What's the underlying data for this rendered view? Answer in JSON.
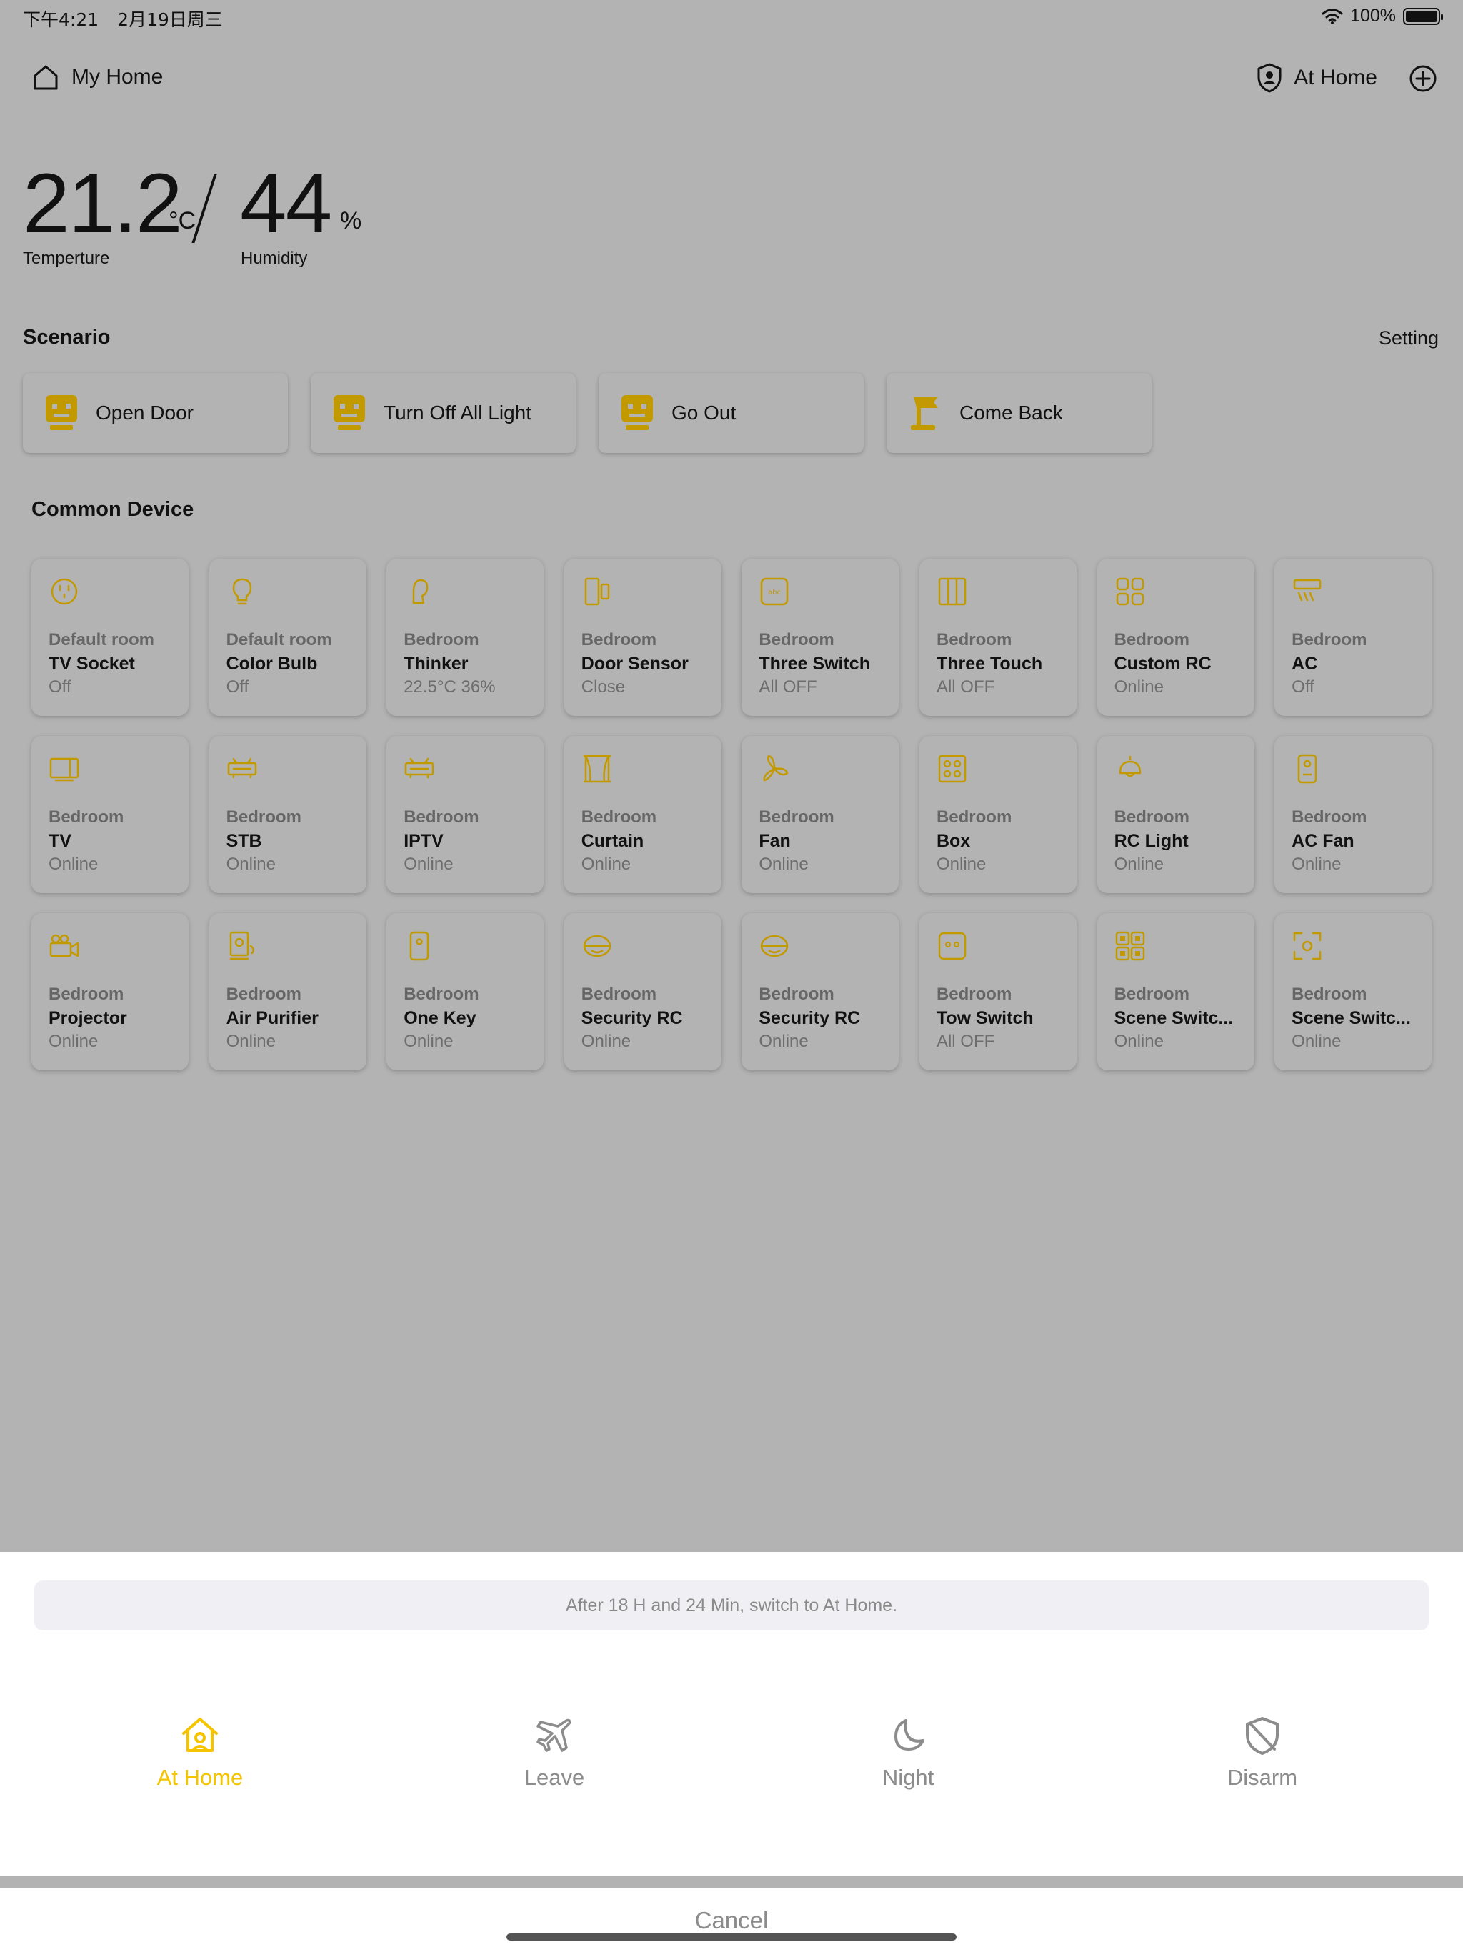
{
  "status_bar": {
    "time": "下午4:21",
    "date": "2月19日周三",
    "battery": "100%",
    "wifi_icon": "wifi-icon",
    "battery_icon": "battery-icon"
  },
  "header": {
    "home_label": "My Home",
    "mode_label": "At Home"
  },
  "climate": {
    "temperature": "21.2",
    "temperature_unit": "°C",
    "temperature_label": "Temperture",
    "humidity": "44",
    "humidity_unit": "%",
    "humidity_label": "Humidity"
  },
  "scenario": {
    "title": "Scenario",
    "setting_label": "Setting",
    "items": [
      {
        "label": "Open Door",
        "icon": "robot-icon"
      },
      {
        "label": "Turn Off All Light",
        "icon": "robot-icon"
      },
      {
        "label": "Go Out",
        "icon": "robot-icon"
      },
      {
        "label": "Come Back",
        "icon": "flag-icon"
      }
    ]
  },
  "devices": {
    "title": "Common Device",
    "items": [
      {
        "room": "Default room",
        "name": "TV Socket",
        "state": "Off",
        "icon": "socket-icon"
      },
      {
        "room": "Default room",
        "name": "Color Bulb",
        "state": "Off",
        "icon": "bulb-icon"
      },
      {
        "room": "Bedroom",
        "name": "Thinker",
        "state": "22.5°C 36%",
        "icon": "thinker-icon"
      },
      {
        "room": "Bedroom",
        "name": "Door Sensor",
        "state": "Close",
        "icon": "door-sensor-icon"
      },
      {
        "room": "Bedroom",
        "name": "Three Switch",
        "state": "All OFF",
        "icon": "switch-panel-icon"
      },
      {
        "room": "Bedroom",
        "name": "Three Touch",
        "state": "All OFF",
        "icon": "touch-panel-icon"
      },
      {
        "room": "Bedroom",
        "name": "Custom RC",
        "state": "Online",
        "icon": "custom-rc-icon"
      },
      {
        "room": "Bedroom",
        "name": "AC",
        "state": "Off",
        "icon": "ac-icon"
      },
      {
        "room": "Bedroom",
        "name": "TV",
        "state": "Online",
        "icon": "tv-icon"
      },
      {
        "room": "Bedroom",
        "name": "STB",
        "state": "Online",
        "icon": "stb-icon"
      },
      {
        "room": "Bedroom",
        "name": "IPTV",
        "state": "Online",
        "icon": "iptv-icon"
      },
      {
        "room": "Bedroom",
        "name": "Curtain",
        "state": "Online",
        "icon": "curtain-icon"
      },
      {
        "room": "Bedroom",
        "name": "Fan",
        "state": "Online",
        "icon": "fan-icon"
      },
      {
        "room": "Bedroom",
        "name": "Box",
        "state": "Online",
        "icon": "box-icon"
      },
      {
        "room": "Bedroom",
        "name": "RC Light",
        "state": "Online",
        "icon": "lamp-icon"
      },
      {
        "room": "Bedroom",
        "name": "AC Fan",
        "state": "Online",
        "icon": "ac-fan-icon"
      },
      {
        "room": "Bedroom",
        "name": "Projector",
        "state": "Online",
        "icon": "projector-icon"
      },
      {
        "room": "Bedroom",
        "name": "Air Purifier",
        "state": "Online",
        "icon": "air-purifier-icon"
      },
      {
        "room": "Bedroom",
        "name": "One Key",
        "state": "Online",
        "icon": "one-key-icon"
      },
      {
        "room": "Bedroom",
        "name": "Security RC",
        "state": "Online",
        "icon": "security-rc-icon"
      },
      {
        "room": "Bedroom",
        "name": "Security RC",
        "state": "Online",
        "icon": "security-rc-icon"
      },
      {
        "room": "Bedroom",
        "name": "Tow Switch",
        "state": "All OFF",
        "icon": "two-switch-icon"
      },
      {
        "room": "Bedroom",
        "name": "Scene Switc...",
        "state": "Online",
        "icon": "scene-switch-icon"
      },
      {
        "room": "Bedroom",
        "name": "Scene Switc...",
        "state": "Online",
        "icon": "scene-switch-icon"
      }
    ]
  },
  "sheet": {
    "notice": "After 18 H and 24 Min, switch to At Home.",
    "modes": [
      {
        "label": "At Home",
        "icon": "home-shield-icon",
        "active": true
      },
      {
        "label": "Leave",
        "icon": "airplane-icon",
        "active": false
      },
      {
        "label": "Night",
        "icon": "moon-icon",
        "active": false
      },
      {
        "label": "Disarm",
        "icon": "disarm-shield-icon",
        "active": false
      }
    ],
    "cancel_label": "Cancel"
  },
  "colors": {
    "accent": "#f5c400",
    "icon_gold": "#c29a00",
    "overlay_bg": "#b3b3b3",
    "sheet_bg": "#ffffff",
    "muted_text": "#8c8c8c"
  }
}
